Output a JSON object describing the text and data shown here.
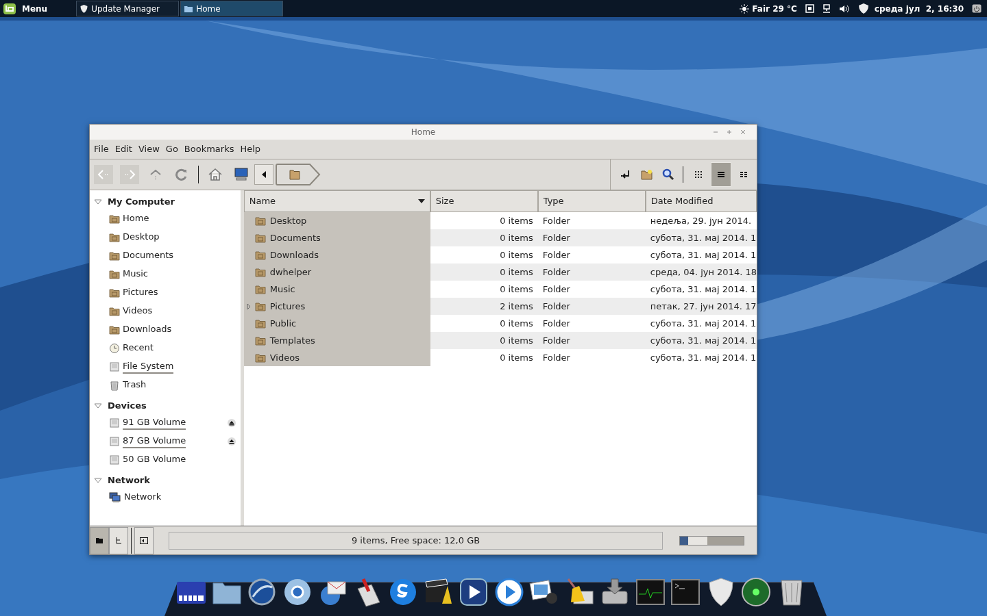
{
  "panel": {
    "menu_label": "Menu",
    "tasks": [
      {
        "label": "Update Manager",
        "kind": "shield",
        "selected": false
      },
      {
        "label": "Home",
        "kind": "folder",
        "selected": true
      }
    ],
    "weather": "Fair 29 °C",
    "clock": "среда јул  2, 16:30"
  },
  "window": {
    "title": "Home",
    "menu": [
      "File",
      "Edit",
      "View",
      "Go",
      "Bookmarks",
      "Help"
    ],
    "view_buttons": [
      {
        "kind": "icons",
        "selected": false
      },
      {
        "kind": "list",
        "selected": true
      },
      {
        "kind": "compact",
        "selected": false
      }
    ],
    "sidebar": [
      {
        "title": "My Computer",
        "expanded": true,
        "items": [
          {
            "label": "Home",
            "kind": "home",
            "usage_bar": false,
            "ejectable": false
          },
          {
            "label": "Desktop",
            "kind": "folder",
            "usage_bar": false,
            "ejectable": false
          },
          {
            "label": "Documents",
            "kind": "folder",
            "usage_bar": false,
            "ejectable": false
          },
          {
            "label": "Music",
            "kind": "music",
            "usage_bar": false,
            "ejectable": false
          },
          {
            "label": "Pictures",
            "kind": "folder",
            "usage_bar": false,
            "ejectable": false
          },
          {
            "label": "Videos",
            "kind": "video",
            "usage_bar": false,
            "ejectable": false
          },
          {
            "label": "Downloads",
            "kind": "folder",
            "usage_bar": false,
            "ejectable": false
          },
          {
            "label": "Recent",
            "kind": "recent",
            "usage_bar": false,
            "ejectable": false
          },
          {
            "label": "File System",
            "kind": "drive",
            "usage_bar": true,
            "ejectable": false
          },
          {
            "label": "Trash",
            "kind": "trash",
            "usage_bar": false,
            "ejectable": false
          }
        ]
      },
      {
        "title": "Devices",
        "expanded": true,
        "items": [
          {
            "label": "91 GB Volume",
            "kind": "drive",
            "usage_bar": true,
            "ejectable": true
          },
          {
            "label": "87 GB Volume",
            "kind": "drive",
            "usage_bar": true,
            "ejectable": true
          },
          {
            "label": "50 GB Volume",
            "kind": "drive",
            "usage_bar": false,
            "ejectable": false
          }
        ]
      },
      {
        "title": "Network",
        "expanded": true,
        "items": [
          {
            "label": "Network",
            "kind": "network",
            "usage_bar": false,
            "ejectable": false
          }
        ]
      }
    ],
    "columns": [
      {
        "label": "Name",
        "sorted": true
      },
      {
        "label": "Size",
        "sorted": false
      },
      {
        "label": "Type",
        "sorted": false
      },
      {
        "label": "Date Modified",
        "sorted": false
      }
    ],
    "rows": [
      {
        "name": "Desktop",
        "size": "0 items",
        "type": "Folder",
        "date": "недеља, 29. јун 2014.",
        "expandable": false,
        "selected": true
      },
      {
        "name": "Documents",
        "size": "0 items",
        "type": "Folder",
        "date": "субота, 31. мај 2014. 1",
        "expandable": false,
        "selected": true
      },
      {
        "name": "Downloads",
        "size": "0 items",
        "type": "Folder",
        "date": "субота, 31. мај 2014. 1",
        "expandable": false,
        "selected": true
      },
      {
        "name": "dwhelper",
        "size": "0 items",
        "type": "Folder",
        "date": "среда, 04. јун 2014. 18",
        "expandable": false,
        "selected": true
      },
      {
        "name": "Music",
        "size": "0 items",
        "type": "Folder",
        "date": "субота, 31. мај 2014. 1",
        "expandable": false,
        "selected": true
      },
      {
        "name": "Pictures",
        "size": "2 items",
        "type": "Folder",
        "date": "петак, 27. јун 2014. 17",
        "expandable": true,
        "selected": true
      },
      {
        "name": "Public",
        "size": "0 items",
        "type": "Folder",
        "date": "субота, 31. мај 2014. 1",
        "expandable": false,
        "selected": true
      },
      {
        "name": "Templates",
        "size": "0 items",
        "type": "Folder",
        "date": "субота, 31. мај 2014. 1",
        "expandable": false,
        "selected": true
      },
      {
        "name": "Videos",
        "size": "0 items",
        "type": "Folder",
        "date": "субота, 31. мај 2014. 1",
        "expandable": false,
        "selected": true
      }
    ],
    "pane_buttons": [
      {
        "kind": "places",
        "selected": true
      },
      {
        "kind": "tree",
        "selected": false
      }
    ],
    "status": "9 items, Free space: 12,0 GB",
    "zoom": {
      "level": 0.13
    }
  }
}
